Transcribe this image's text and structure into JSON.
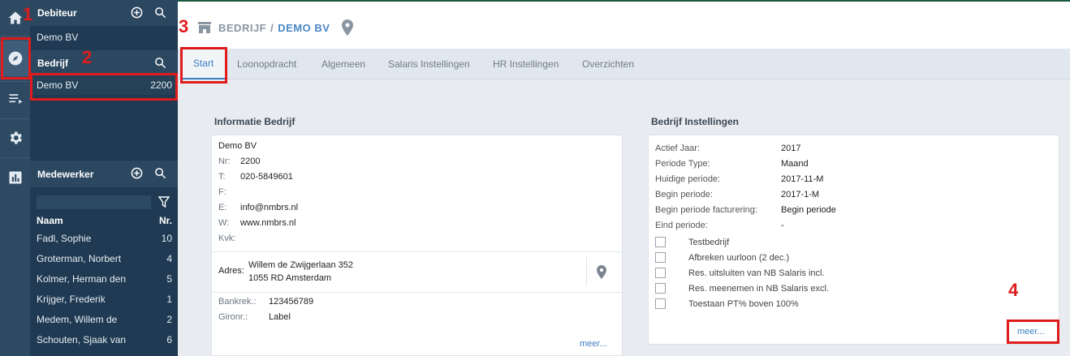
{
  "sidebar_icons": [
    "home-icon",
    "compass-icon",
    "list-icon",
    "gear-icon",
    "chart-icon"
  ],
  "debiteur": {
    "title": "Debiteur",
    "item": "Demo BV"
  },
  "bedrijf": {
    "title": "Bedrijf",
    "item": "Demo BV",
    "item_nr": "2200"
  },
  "medewerker": {
    "title": "Medewerker",
    "filter_value": "",
    "col_naam": "Naam",
    "col_nr": "Nr.",
    "rows": [
      {
        "name": "Fadl, Sophie",
        "nr": "10"
      },
      {
        "name": "Groterman, Norbert",
        "nr": "4"
      },
      {
        "name": "Kolmer, Herman den",
        "nr": "5"
      },
      {
        "name": "Krijger, Frederik",
        "nr": "1"
      },
      {
        "name": "Medem, Willem de",
        "nr": "2"
      },
      {
        "name": "Schouten, Sjaak van",
        "nr": "6"
      }
    ]
  },
  "header": {
    "crumb_1": "BEDRIJF",
    "crumb_sep": "/",
    "crumb_2": "DEMO BV"
  },
  "tabs": [
    "Start",
    "Loonopdracht",
    "Algemeen",
    "Salaris Instellingen",
    "HR Instellingen",
    "Overzichten"
  ],
  "info": {
    "title": "Informatie Bedrijf",
    "name": "Demo BV",
    "nr_label": "Nr:",
    "nr": "2200",
    "t_label": "T:",
    "t": "020-5849601",
    "f_label": "F:",
    "f": "",
    "e_label": "E:",
    "e": "info@nmbrs.nl",
    "w_label": "W:",
    "w": "www.nmbrs.nl",
    "kvk_label": "Kvk:",
    "kvk": "",
    "adres_label": "Adres:",
    "adres_1": "Willem de Zwijgerlaan 352",
    "adres_2": "1055 RD Amsterdam",
    "bank_label": "Bankrek.:",
    "bank": "123456789",
    "giro_label": "Gironr.:",
    "giro": "Label",
    "meer": "meer..."
  },
  "settings": {
    "title": "Bedrijf Instellingen",
    "rows": [
      {
        "label": "Actief Jaar:",
        "value": "2017"
      },
      {
        "label": "Periode Type:",
        "value": "Maand"
      },
      {
        "label": "Huidige periode:",
        "value": "2017-11-M"
      },
      {
        "label": "Begin periode:",
        "value": "2017-1-M"
      },
      {
        "label": "Begin periode facturering:",
        "value": "Begin periode"
      },
      {
        "label": "Eind periode:",
        "value": "-"
      }
    ],
    "checkboxes": [
      {
        "label": "Testbedrijf",
        "checked": false
      },
      {
        "label": "Afbreken uurloon (2 dec.)",
        "checked": false
      },
      {
        "label": "Res. uitsluiten van NB Salaris incl.",
        "checked": false
      },
      {
        "label": "Res. meenemen in NB Salaris excl.",
        "checked": false
      },
      {
        "label": "Toestaan PT% boven 100%",
        "checked": false
      }
    ],
    "meer": "meer..."
  },
  "annotations": [
    "1",
    "2",
    "3",
    "4"
  ]
}
